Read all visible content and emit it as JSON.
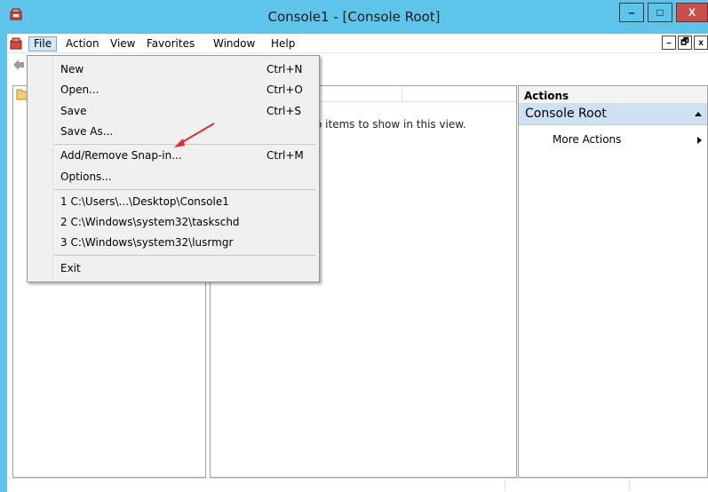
{
  "window": {
    "title": "Console1 - [Console Root]",
    "controls": {
      "minimize": "–",
      "maximize": "□",
      "close": "X"
    }
  },
  "menubar": {
    "items": [
      "File",
      "Action",
      "View",
      "Favorites",
      "Window",
      "Help"
    ],
    "open_menu": "File",
    "mdi_controls": [
      "–",
      "🗗",
      "x"
    ]
  },
  "file_menu": {
    "items": [
      {
        "label": "New",
        "shortcut": "Ctrl+N"
      },
      {
        "label": "Open...",
        "shortcut": "Ctrl+O"
      },
      {
        "label": "Save",
        "shortcut": "Ctrl+S"
      },
      {
        "label": "Save As...",
        "shortcut": ""
      },
      {
        "label": "Add/Remove Snap-in...",
        "shortcut": "Ctrl+M"
      },
      {
        "label": "Options...",
        "shortcut": ""
      },
      {
        "label": "1 C:\\Users\\...\\Desktop\\Console1",
        "shortcut": ""
      },
      {
        "label": "2 C:\\Windows\\system32\\taskschd",
        "shortcut": ""
      },
      {
        "label": "3 C:\\Windows\\system32\\lusrmgr",
        "shortcut": ""
      },
      {
        "label": "Exit",
        "shortcut": ""
      }
    ]
  },
  "middle_pane": {
    "empty_message": "o items to show in this view."
  },
  "actions_pane": {
    "header": "Actions",
    "section": "Console Root",
    "items": [
      "More Actions"
    ]
  },
  "colors": {
    "titlebar": "#5ec4ea",
    "close_button": "#c7504a",
    "menu_highlight": "#d6e8f7",
    "actions_section": "#cfe0f3",
    "annotation_arrow": "#e52b2b"
  },
  "icons": [
    "mmc-app-icon",
    "back-arrow-icon",
    "folder-icon",
    "collapse-up-icon",
    "expand-right-icon"
  ]
}
